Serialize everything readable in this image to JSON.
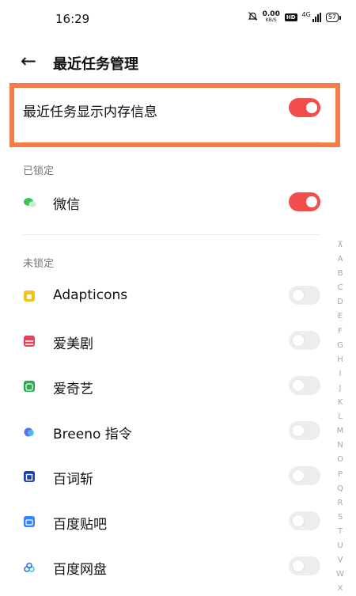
{
  "status": {
    "time": "16:29",
    "speed_value": "0.00",
    "speed_unit": "KB/S",
    "hd": "HD",
    "network": "4G",
    "battery": "57"
  },
  "header": {
    "back_icon": "←",
    "title": "最近任务管理"
  },
  "memory_toggle": {
    "label": "最近任务显示内存信息",
    "on": true
  },
  "locked_section": {
    "heading": "已锁定",
    "apps": [
      {
        "label": "微信",
        "icon": "wechat-icon",
        "color": "#39c35b",
        "on": true
      }
    ]
  },
  "unlocked_section": {
    "heading": "未锁定",
    "apps": [
      {
        "label": "Adapticons",
        "icon": "adapticons-icon",
        "color": "#f5c21b",
        "on": false
      },
      {
        "label": "爱美剧",
        "icon": "aimeiju-icon",
        "color": "#e2445a",
        "on": false
      },
      {
        "label": "爱奇艺",
        "icon": "iqiyi-icon",
        "color": "#2fa84f",
        "on": false
      },
      {
        "label": "Breeno 指令",
        "icon": "breeno-icon",
        "color": "#5b6ef0",
        "on": false
      },
      {
        "label": "百词斩",
        "icon": "baicizhan-icon",
        "color": "#1d3fb0",
        "on": false
      },
      {
        "label": "百度贴吧",
        "icon": "tieba-icon",
        "color": "#3385ff",
        "on": false
      },
      {
        "label": "百度网盘",
        "icon": "baidu-netdisk-icon",
        "color": "#2f6fe8",
        "on": false
      }
    ]
  },
  "index_letters": [
    "⊼",
    "A",
    "B",
    "C",
    "D",
    "E",
    "F",
    "G",
    "H",
    "I",
    "J",
    "K",
    "L",
    "M",
    "N",
    "O",
    "P",
    "Q",
    "R",
    "S",
    "T",
    "U",
    "V",
    "W",
    "X"
  ]
}
